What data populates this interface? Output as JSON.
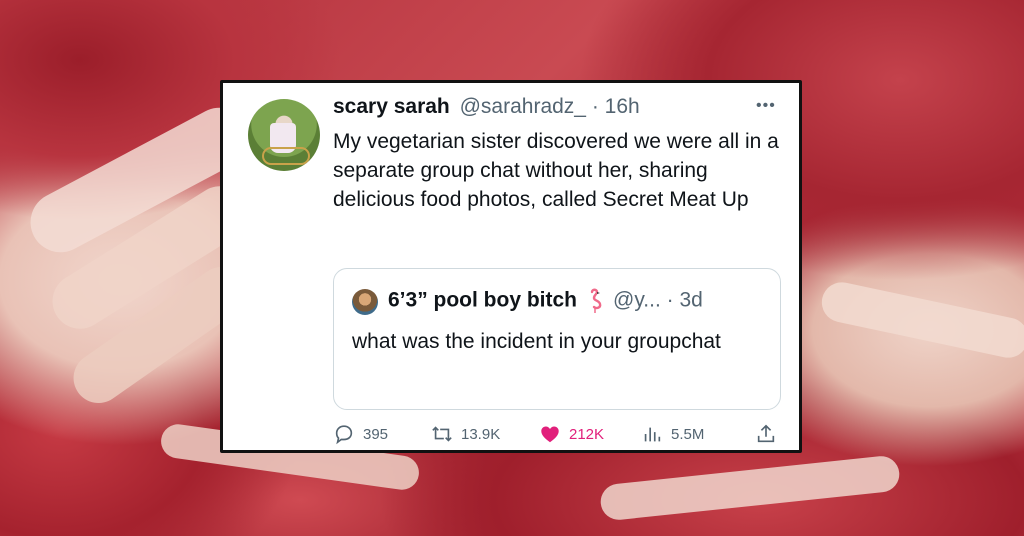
{
  "tweet": {
    "display_name": "scary sarah",
    "handle": "@sarahradz_",
    "separator": " · ",
    "time": "16h",
    "more_icon": "more-horizontal-icon",
    "text": "My vegetarian sister discovered we were all in a separate group chat without her, sharing delicious food photos, called Secret Meat Up"
  },
  "quote": {
    "display_name": "6’3” pool boy bitch",
    "emoji_icon": "flamingo-icon",
    "handle": "@y...",
    "separator": " · ",
    "time": "3d",
    "text": "what was the incident in your groupchat"
  },
  "actions": {
    "replies": "395",
    "reposts": "13.9K",
    "likes": "212K",
    "views": "5.5M",
    "reply_icon": "reply-icon",
    "repost_icon": "repost-icon",
    "like_icon": "heart-icon",
    "views_icon": "views-chart-icon",
    "share_icon": "share-icon"
  },
  "colors": {
    "like_active": "#e1207b",
    "muted_text": "#536471",
    "primary_text": "#0f1419",
    "background_meat": "#b8343f"
  }
}
